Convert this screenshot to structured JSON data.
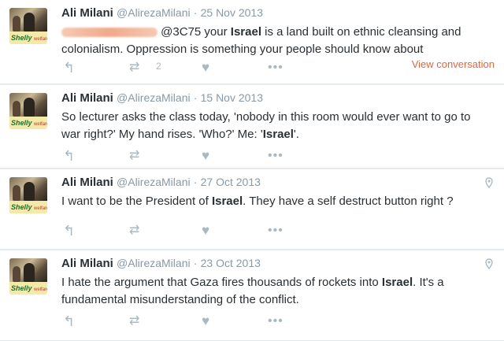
{
  "tweets": [
    {
      "name": "Ali Milani",
      "handle": "@AlirezaMilani",
      "sep": "·",
      "date": "25 Nov 2013",
      "line1_mention": "@3C75 your ",
      "line1_bold": "Israel",
      "line1_rest": " is a land built on ethnic cleansing and",
      "line2": "colonialism. Oppression is something your people should know about",
      "retweet_count": "2",
      "view_conversation": "View conversation"
    },
    {
      "name": "Ali Milani",
      "handle": "@AlirezaMilani",
      "sep": "·",
      "date": "15 Nov 2013",
      "line1": "So lecturer asks the class today, 'nobody in this room would ever want to go to",
      "line2_pre": "war right?' My hand rises. 'Who?' Me: '",
      "line2_bold": "Israel",
      "line2_post": "'."
    },
    {
      "name": "Ali Milani",
      "handle": "@AlirezaMilani",
      "sep": "·",
      "date": "27 Oct 2013",
      "line1_pre": "I want to be the President of ",
      "line1_bold": "Israel",
      "line1_post": ". They have a self destruct button right ?"
    },
    {
      "name": "Ali Milani",
      "handle": "@AlirezaMilani",
      "sep": "·",
      "date": "23 Oct 2013",
      "line1_pre": "I hate the argument that Gaza fires thousands of rockets into ",
      "line1_bold": "Israel",
      "line1_post": ". It's a",
      "line2": "fundamental misunderstanding of the conflict."
    }
  ],
  "avatar": {
    "brand": "Shelly",
    "brand_sub": "welfare"
  },
  "icons": {
    "reply": "reply-icon",
    "retweet": "retweet-icon",
    "like": "heart-icon",
    "more": "more-icon",
    "location": "location-pin-icon"
  },
  "colors": {
    "action_grey": "#aab8c2",
    "link_orange": "#e0683c",
    "meta_grey": "#8899a6"
  }
}
